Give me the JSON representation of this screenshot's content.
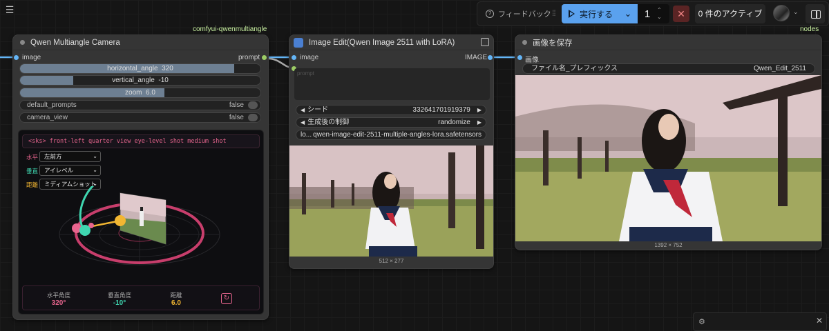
{
  "toolbar": {
    "feedback_label": "フィードバック",
    "run_label": "実行する",
    "queue_count": "1",
    "active_label": "0 件のアクティブ"
  },
  "groups": {
    "left_label": "comfyui-qwenmultiangle",
    "right_label": "nodes"
  },
  "camera_node": {
    "title": "Qwen Multiangle Camera",
    "input_label": "image",
    "output_label": "prompt",
    "horizontal": {
      "label": "horizontal_angle",
      "value": "320",
      "fill": 0.89
    },
    "vertical": {
      "label": "vertical_angle",
      "value": "-10",
      "fill": 0.22
    },
    "zoom": {
      "label": "zoom",
      "value": "6.0",
      "fill": 0.6
    },
    "default_prompts": {
      "label": "default_prompts",
      "value": "false"
    },
    "camera_view": {
      "label": "camera_view",
      "value": "false"
    },
    "prompt_text": "<sks> front-left quarter view eye-level shot medium shot",
    "selects": [
      {
        "label": "水平",
        "value": "左前方",
        "color": "#e8658e"
      },
      {
        "label": "垂直",
        "value": "アイレベル",
        "color": "#3fd6b0"
      },
      {
        "label": "距離",
        "value": "ミディアムショット",
        "color": "#f2b632"
      }
    ],
    "stats": [
      {
        "label": "水平角度",
        "value": "320°",
        "color": "#e8658e"
      },
      {
        "label": "垂直角度",
        "value": "-10°",
        "color": "#3fd6b0"
      },
      {
        "label": "距離",
        "value": "6.0",
        "color": "#f2b632"
      }
    ]
  },
  "edit_node": {
    "title": "Image Edit(Qwen Image 2511 with LoRA)",
    "input_label": "image",
    "output_label": "IMAGE",
    "prompt_placeholder": "prompt",
    "seed": {
      "label": "シード",
      "value": "332641701919379"
    },
    "control": {
      "label": "生成後の制御",
      "value": "randomize"
    },
    "lora": {
      "label": "lo...",
      "value": "qwen-image-edit-2511-multiple-angles-lora.safetensors"
    },
    "image_size": "512 × 277"
  },
  "save_node": {
    "title": "画像を保存",
    "input_label": "画像",
    "prefix": {
      "label": "ファイル名_プレフィックス",
      "value": "Qwen_Edit_2511"
    },
    "image_size": "1392 × 752"
  },
  "colors": {
    "accent_blue": "#5aa1ee",
    "image_socket": "#64b5f6",
    "string_socket": "#9ccc65",
    "pink": "#e8658e",
    "teal": "#3fd6b0",
    "amber": "#f2b632"
  }
}
